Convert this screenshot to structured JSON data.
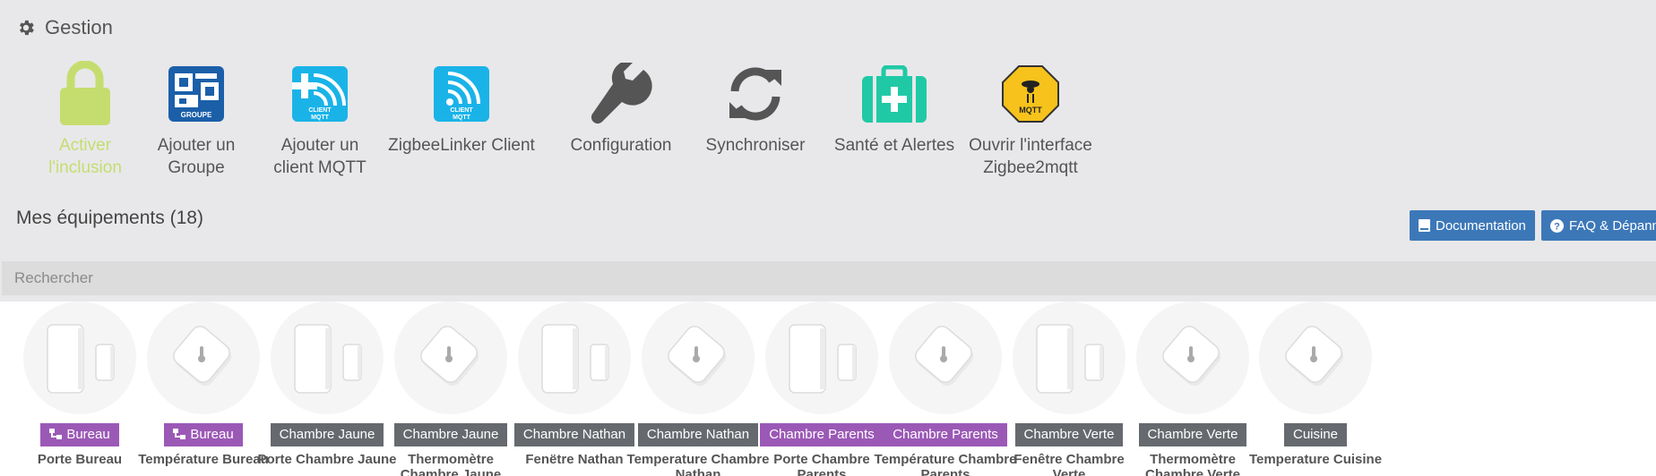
{
  "gestion": {
    "title": "Gestion",
    "actions": [
      {
        "label": "Activer\nl'inclusion",
        "icon": "lock-icon",
        "color": "#c5dd6f"
      },
      {
        "label": "Ajouter un\nGroupe",
        "icon": "groupe-icon",
        "color": "#1b5fa9"
      },
      {
        "label": "Ajouter un\nclient MQTT",
        "icon": "client-mqtt-add-icon",
        "color": "#1ab3e8"
      },
      {
        "label": "ZigbeeLinker Client",
        "icon": "client-mqtt-icon",
        "color": "#1ab3e8"
      },
      {
        "label": "Configuration",
        "icon": "wrench-icon",
        "color": "#555555"
      },
      {
        "label": "Synchroniser",
        "icon": "sync-icon",
        "color": "#555555"
      },
      {
        "label": "Santé et Alertes",
        "icon": "medkit-icon",
        "color": "#20c9a6"
      },
      {
        "label": "Ouvrir l'interface\nZigbee2mqtt",
        "icon": "zigbee2mqtt-icon",
        "color": "#f6c21b"
      }
    ],
    "groupe_icon_text": "GROUPE",
    "client_icon_text": "CLIENT",
    "mqtt_icon_text": "MQTT"
  },
  "equipements": {
    "title": "Mes équipements (18)",
    "documentation_label": "Documentation",
    "faq_label": "FAQ & Dépanna",
    "search_placeholder": "Rechercher",
    "items": [
      {
        "room": "Bureau",
        "room_color": "purple",
        "has_obj_icon": true,
        "name": "Porte Bureau",
        "device": "door-sensor"
      },
      {
        "room": "Bureau",
        "room_color": "purple",
        "has_obj_icon": true,
        "name": "Température Bureau",
        "device": "thermometer"
      },
      {
        "room": "Chambre Jaune",
        "room_color": "grey",
        "name": "Porte Chambre Jaune",
        "device": "door-sensor"
      },
      {
        "room": "Chambre Jaune",
        "room_color": "grey",
        "name": "Thermomètre Chambre Jaune",
        "device": "thermometer"
      },
      {
        "room": "Chambre Nathan",
        "room_color": "grey",
        "name": "Fenëtre Nathan",
        "device": "door-sensor"
      },
      {
        "room": "Chambre Nathan",
        "room_color": "grey",
        "name": "Temperature Chambre Nathan",
        "device": "thermometer"
      },
      {
        "room": "Chambre Parents",
        "room_color": "purple",
        "name": "Porte Chambre Parents",
        "device": "door-sensor"
      },
      {
        "room": "Chambre Parents",
        "room_color": "purple",
        "name": "Température Chambre Parents",
        "device": "thermometer"
      },
      {
        "room": "Chambre Verte",
        "room_color": "grey",
        "name": "Fenêtre Chambre Verte",
        "device": "door-sensor"
      },
      {
        "room": "Chambre Verte",
        "room_color": "grey",
        "name": "Thermomètre Chambre Verte",
        "device": "thermometer"
      },
      {
        "room": "Cuisine",
        "room_color": "grey",
        "name": "Temperature Cuisine",
        "device": "thermometer"
      }
    ]
  }
}
